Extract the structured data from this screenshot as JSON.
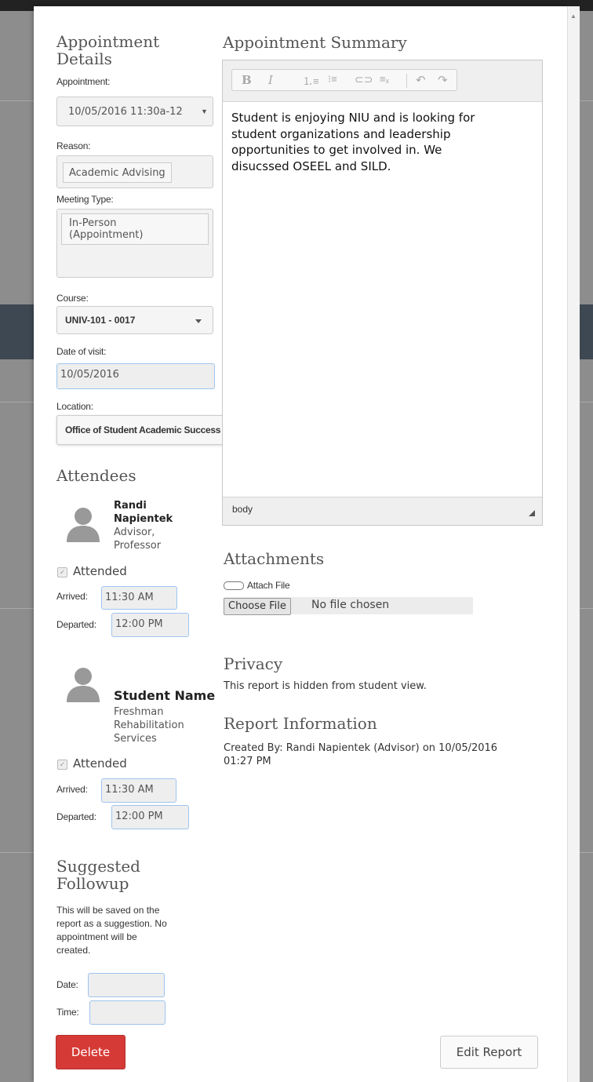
{
  "details": {
    "heading_line1": "Appointment",
    "heading_line2": "Details",
    "appointment_label": "Appointment:",
    "appointment_value": "10/05/2016 11:30a-12",
    "reason_label": "Reason:",
    "reason_value": "Academic Advising",
    "meeting_type_label": "Meeting Type:",
    "meeting_type_line1": "In-Person",
    "meeting_type_line2": "(Appointment)",
    "course_label": "Course:",
    "course_value": "UNIV-101 - 0017",
    "date_label": "Date of visit:",
    "date_value": "10/05/2016",
    "location_label": "Location:",
    "location_value": "Office of Student Academic Success (OSAS)"
  },
  "summary": {
    "heading": "Appointment Summary",
    "text_lines": [
      "Student is enjoying NIU and is looking for",
      "student organizations and leadership",
      "opportunities to get involved in. We",
      "disucssed OSEEL and SILD."
    ],
    "status_path": "body"
  },
  "attendees": {
    "heading": "Attendees",
    "people": [
      {
        "name_line1": "Randi",
        "name_line2": "Napientek",
        "role_line1": "Advisor,",
        "role_line2": "Professor",
        "attended_label": "Attended",
        "arrived_label": "Arrived:",
        "arrived_value": "11:30 AM",
        "departed_label": "Departed:",
        "departed_value": "12:00 PM"
      },
      {
        "name_line1": "Student Name",
        "role_line1": "Freshman",
        "role_line2": "Rehabilitation",
        "role_line3": "Services",
        "attended_label": "Attended",
        "arrived_label": "Arrived:",
        "arrived_value": "11:30 AM",
        "departed_label": "Departed:",
        "departed_value": "12:00 PM"
      }
    ]
  },
  "attachments": {
    "heading": "Attachments",
    "attach_label": "Attach File",
    "choose_button": "Choose File",
    "no_file": "No file chosen"
  },
  "privacy": {
    "heading": "Privacy",
    "text": "This report is hidden from student view."
  },
  "report_info": {
    "heading": "Report Information",
    "line1": "Created By: Randi Napientek (Advisor) on 10/05/2016",
    "line2": "01:27 PM"
  },
  "followup": {
    "heading_line1": "Suggested",
    "heading_line2": "Followup",
    "desc_line1": "This will be saved on the",
    "desc_line2": "report as a suggestion. No",
    "desc_line3": "appointment will be",
    "desc_line4": "created.",
    "date_label": "Date:",
    "time_label": "Time:"
  },
  "actions": {
    "delete_label": "Delete",
    "edit_label": "Edit Report"
  },
  "colors": {
    "danger": "#d63a36",
    "input_focus_border": "#9ec4ee"
  }
}
